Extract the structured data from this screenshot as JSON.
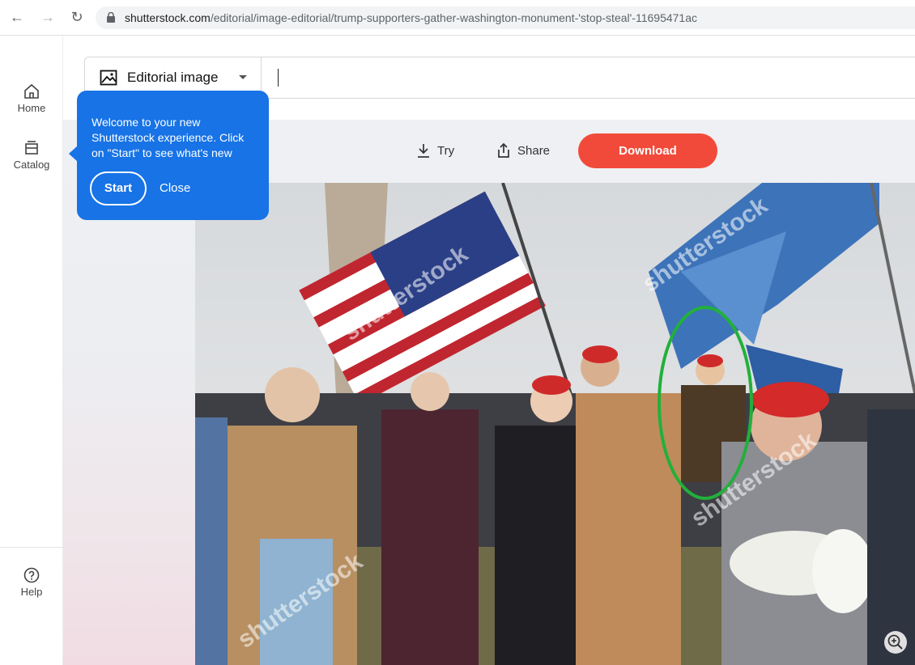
{
  "browser": {
    "url_host": "shutterstock.com",
    "url_path": "/editorial/image-editorial/trump-supporters-gather-washington-monument-'stop-steal'-11695471ac"
  },
  "sidebar": {
    "home_label": "Home",
    "catalog_label": "Catalog",
    "help_label": "Help"
  },
  "search": {
    "type_label": "Editorial image"
  },
  "toolbar": {
    "try_label": "Try",
    "share_label": "Share",
    "download_label": "Download"
  },
  "popover": {
    "message": "Welcome to your new Shutterstock experience. Click on \"Start\" to see what's new",
    "start_label": "Start",
    "close_label": "Close"
  },
  "photo": {
    "watermark_text": "shutterstock",
    "highlight_color": "#22b03a"
  },
  "colors": {
    "accent_blue": "#1773e6",
    "download_red": "#f24a3a"
  }
}
